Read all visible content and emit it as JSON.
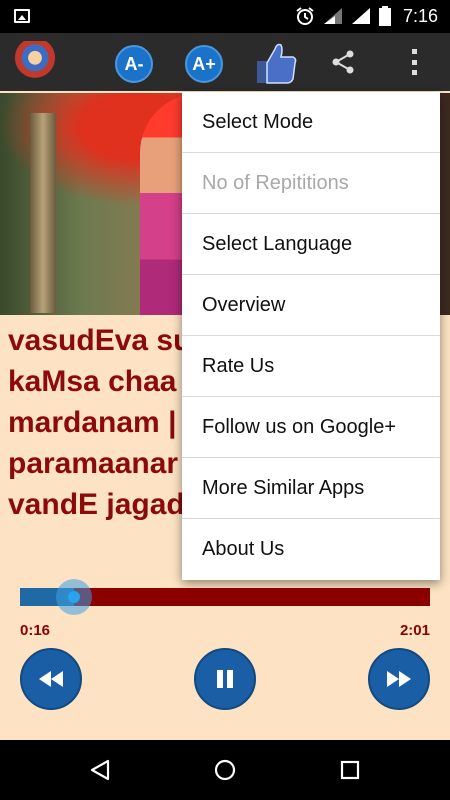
{
  "status_bar": {
    "time": "7:16",
    "icons": [
      "gallery-icon",
      "alarm-icon",
      "wifi-icon",
      "signal-icon",
      "battery-icon"
    ]
  },
  "action_bar": {
    "decrease_font_label": "A-",
    "increase_font_label": "A+",
    "icons": [
      "app-logo",
      "like-icon",
      "share-icon",
      "overflow-menu-icon"
    ]
  },
  "lyrics": {
    "lines": [
      "vasudEva su",
      "kaMsa chaa",
      "mardanam |",
      "paramaanar",
      "vandE jagad"
    ]
  },
  "menu": {
    "items": [
      {
        "label": "Select Mode",
        "enabled": true
      },
      {
        "label": "No of Repititions",
        "enabled": false
      },
      {
        "label": "Select Language",
        "enabled": true
      },
      {
        "label": "Overview",
        "enabled": true
      },
      {
        "label": "Rate Us",
        "enabled": true
      },
      {
        "label": "Follow us on Google+",
        "enabled": true
      },
      {
        "label": "More Similar Apps",
        "enabled": true
      },
      {
        "label": "About Us",
        "enabled": true
      }
    ]
  },
  "player": {
    "elapsed": "0:16",
    "total": "2:01",
    "progress": 0.1322,
    "controls": [
      "rewind-icon",
      "pause-icon",
      "fast-forward-icon"
    ]
  },
  "colors": {
    "lyrics_text": "#8b0a0a",
    "background": "#fde3c4",
    "accent_blue": "#1a5ea6",
    "seek_track": "#8b0000"
  }
}
